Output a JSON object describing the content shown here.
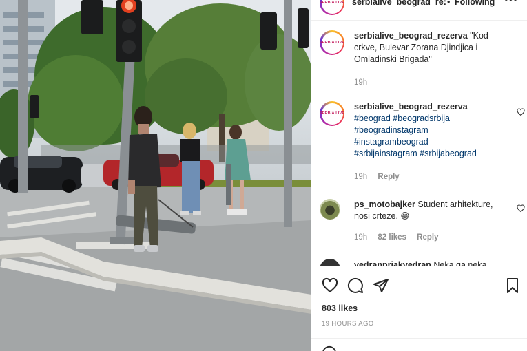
{
  "header": {
    "avatar_text": "SERBIA LIVE",
    "username": "serbialive_beograd_re:",
    "separator": "•",
    "follow_label": "Following",
    "more_icon": "more-horizontal-icon"
  },
  "caption": {
    "username": "serbialive_beograd_rezerva",
    "text": "\"Kod crkve, Bulevar Zorana Djindjica i Omladinski Brigada\"",
    "time": "19h"
  },
  "comments": [
    {
      "username": "serbialive_beograd_rezerva",
      "hashtags": [
        "#beograd #beogradsrbija",
        "#beogradinstagram",
        "#instagrambeograd",
        "#srbijainstagram #srbijabeograd"
      ],
      "time": "19h",
      "reply": "Reply"
    },
    {
      "username": "ps_motobajker",
      "text": "Student arhitekture, nosi crteze. 😁",
      "time": "19h",
      "likes": "82 likes",
      "reply": "Reply"
    },
    {
      "username": "vedranpriakvedran",
      "text": "Neka ga neka"
    }
  ],
  "actions": {
    "like_icon": "heart-icon",
    "comment_icon": "comment-icon",
    "share_icon": "share-icon",
    "save_icon": "bookmark-icon",
    "likes": "803 likes",
    "time_ago": "19 HOURS AGO"
  },
  "colors": {
    "text": "#262626",
    "secondary": "#8e8e8e",
    "hashtag": "#00376b",
    "traffic_light_red": "#e3401f"
  }
}
